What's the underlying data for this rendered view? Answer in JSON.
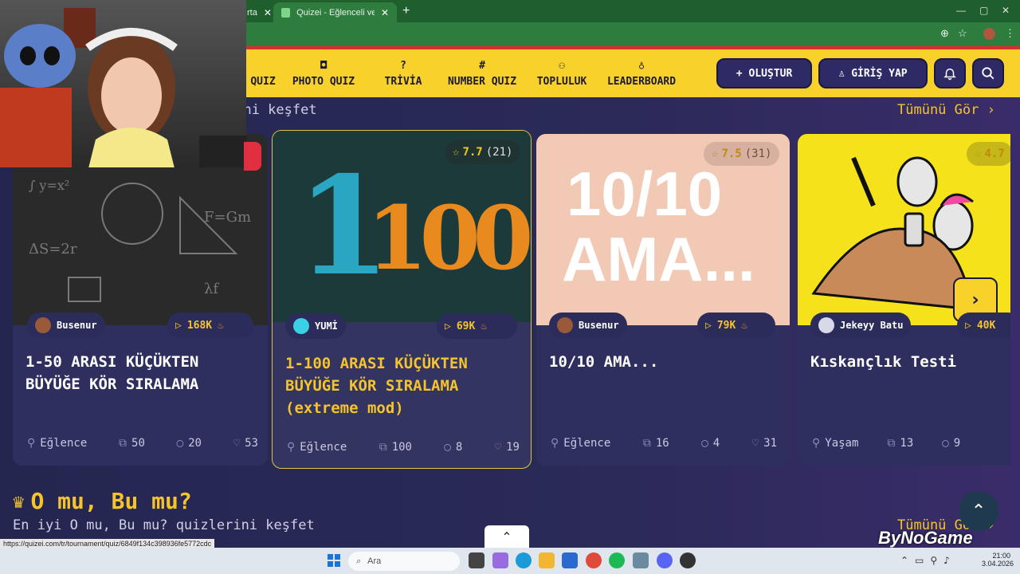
{
  "browser": {
    "tab_prev_label": "rta",
    "tab_active_label": "Quizei - Eğlenceli ve etkileşimli",
    "status_url": "https://quizei.com/tr/tournament/quiz/6849f134c398936fe5772cdc"
  },
  "nav": {
    "items": [
      {
        "label": "QUIZ",
        "icon": "quiz-icon"
      },
      {
        "label": "PHOTO QUIZ",
        "icon": "camera-icon"
      },
      {
        "label": "TRİVİA",
        "icon": "question-icon"
      },
      {
        "label": "NUMBER QUIZ",
        "icon": "hash-icon"
      },
      {
        "label": "TOPLULUK",
        "icon": "users-icon"
      },
      {
        "label": "LEADERBOARD",
        "icon": "medal-icon"
      }
    ],
    "create_label": "OLUŞTUR",
    "login_label": "GİRİŞ YAP"
  },
  "section1": {
    "subtitle": "rini keşfet",
    "see_all": "Tümünü Gör"
  },
  "cards": [
    {
      "author": "Busenur",
      "views": "168K",
      "title": "1-50 ARASI KÜÇÜKTEN BÜYÜĞE KÖR SIRALAMA",
      "category": "Eğlence",
      "questions": "50",
      "comments": "20",
      "likes": "53"
    },
    {
      "author": "YUMİ",
      "views": "69K",
      "rating": "7.7",
      "rating_count": "(21)",
      "thumb_a": "1",
      "thumb_b": "100",
      "title": "1-100 ARASI KÜÇÜKTEN BÜYÜĞE KÖR SIRALAMA (extreme mod)",
      "category": "Eğlence",
      "questions": "100",
      "comments": "8",
      "likes": "19"
    },
    {
      "author": "Busenur",
      "views": "79K",
      "rating": "7.5",
      "rating_count": "(31)",
      "thumb_a": "10/10",
      "thumb_b": "AMA...",
      "title": "10/10 AMA...",
      "category": "Eğlence",
      "questions": "16",
      "comments": "4",
      "likes": "31"
    },
    {
      "author": "Jekeyy Batu",
      "views": "40K",
      "rating": "4.7",
      "title": "Kıskançlık Testi",
      "category": "Yaşam",
      "questions": "13",
      "comments": "9",
      "likes": ""
    }
  ],
  "section2": {
    "title": "O mu, Bu mu?",
    "subtitle": "En iyi O mu, Bu mu? quizlerini keşfet",
    "see_all": "Tümünü Gör"
  },
  "taskbar": {
    "search_placeholder": "Ara",
    "time": "21:00",
    "date": "3.04.2026"
  },
  "watermark": "ByNoGame",
  "colors": {
    "accent": "#f5c42c",
    "header": "#f8d12a",
    "bg": "#2c2a55"
  }
}
